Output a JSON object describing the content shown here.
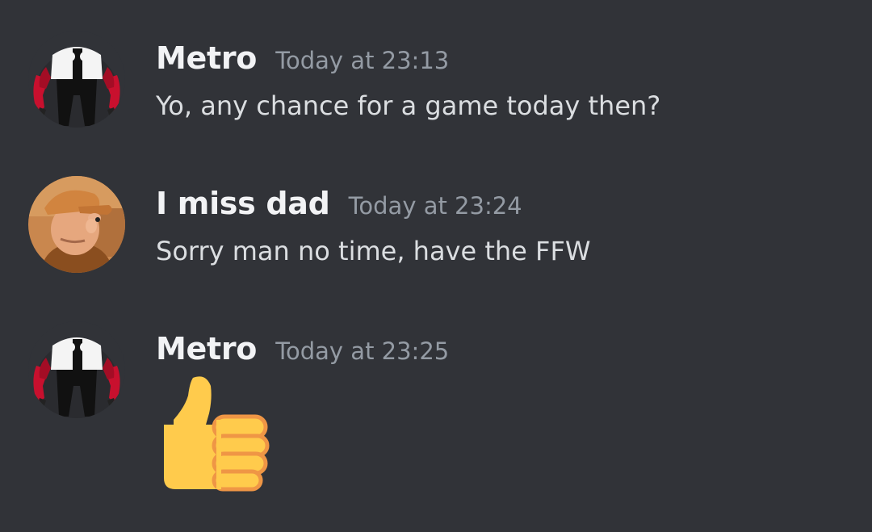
{
  "messages": [
    {
      "username": "Metro",
      "timestamp": "Today at 23:13",
      "avatar_icon": "four-arms-robot-avatar-icon",
      "content": "Yo, any chance for a game today then?"
    },
    {
      "username": "I miss dad",
      "timestamp": "Today at 23:24",
      "avatar_icon": "cartoon-man-cap-avatar-icon",
      "content": "Sorry man no time, have the FFW"
    },
    {
      "username": "Metro",
      "timestamp": "Today at 23:25",
      "avatar_icon": "four-arms-robot-avatar-icon",
      "emoji": "thumbs-up-emoji-icon"
    }
  ],
  "colors": {
    "background": "#313338",
    "username": "#f2f3f5",
    "timestamp": "#949ba4",
    "message_text": "#dbdee1",
    "thumbs_up": "#ffcb4c",
    "thumbs_up_outline": "#ef9645"
  }
}
